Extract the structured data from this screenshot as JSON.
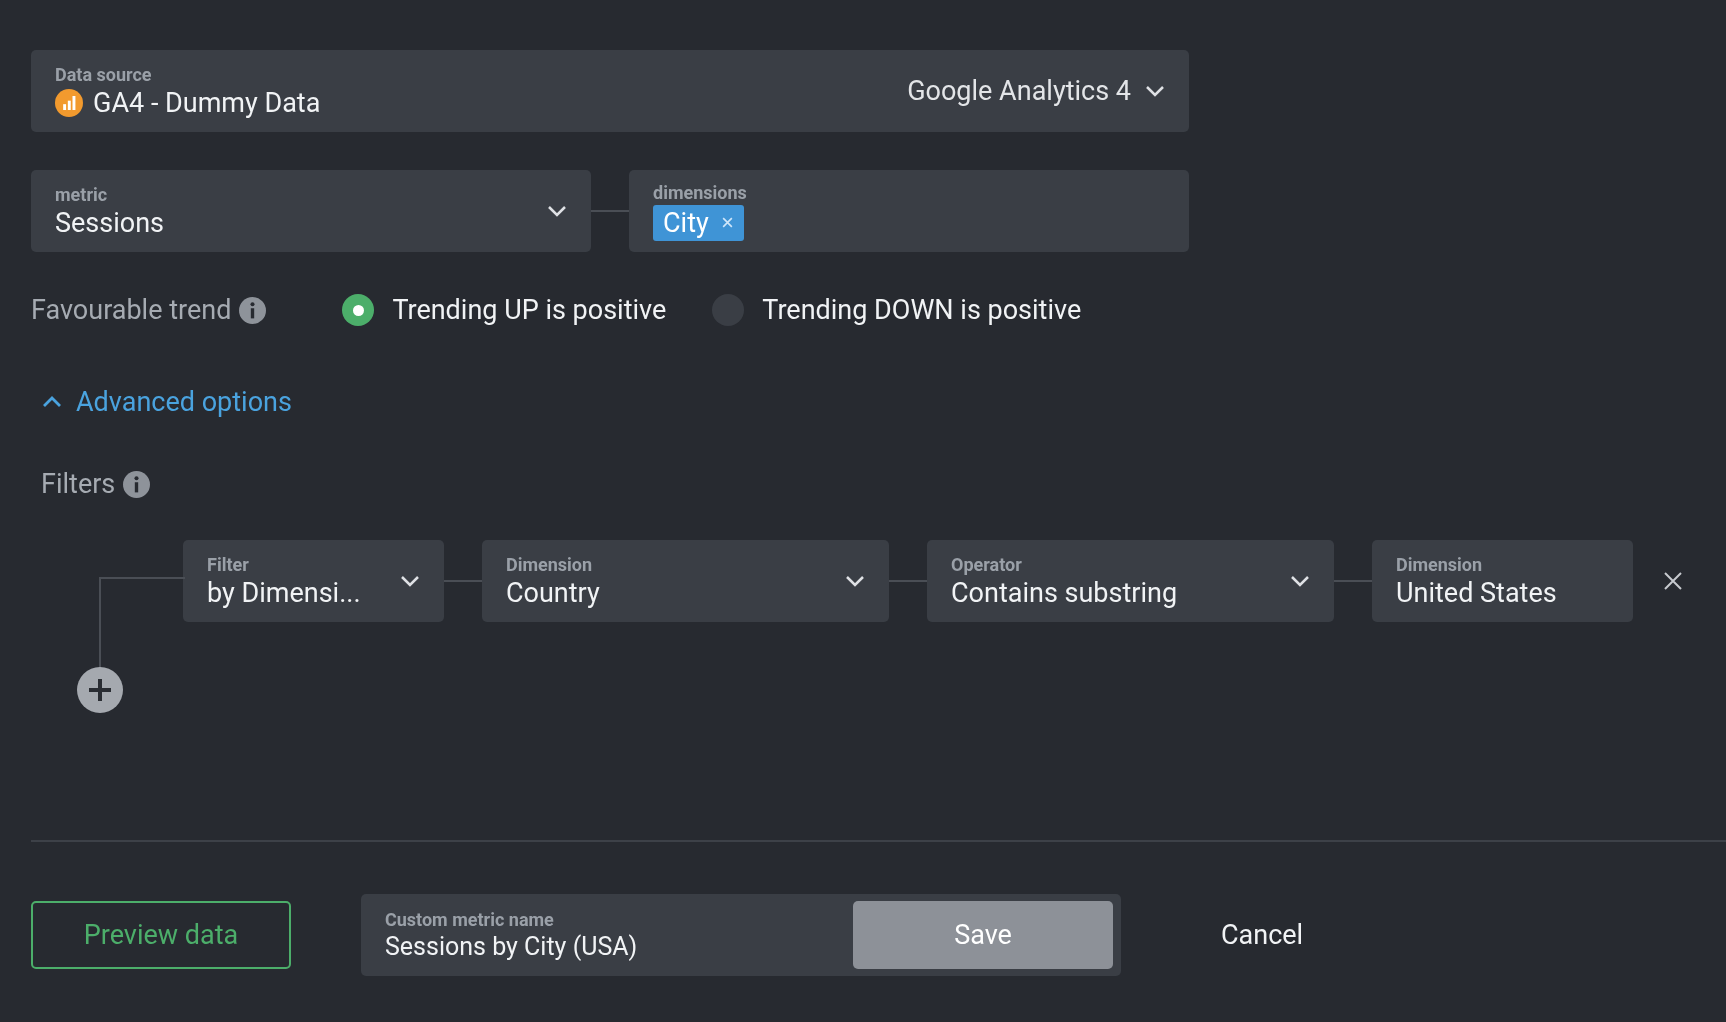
{
  "data_source": {
    "label": "Data source",
    "value": "GA4 - Dummy Data",
    "provider": "Google Analytics 4"
  },
  "metric": {
    "label": "metric",
    "value": "Sessions"
  },
  "dimensions": {
    "label": "dimensions",
    "tags": [
      {
        "text": "City"
      }
    ]
  },
  "trend": {
    "label": "Favourable trend",
    "options": [
      {
        "label": "Trending UP is positive",
        "selected": true
      },
      {
        "label": "Trending DOWN is positive",
        "selected": false
      }
    ]
  },
  "advanced": {
    "label": "Advanced options",
    "expanded": true
  },
  "filters": {
    "label": "Filters",
    "rows": [
      {
        "fields": [
          {
            "kind": "dropdown",
            "label": "Filter",
            "value": "by Dimensi..."
          },
          {
            "kind": "dropdown",
            "label": "Dimension",
            "value": "Country"
          },
          {
            "kind": "dropdown",
            "label": "Operator",
            "value": "Contains substring"
          },
          {
            "kind": "text",
            "label": "Dimension",
            "value": "United States"
          }
        ]
      }
    ]
  },
  "footer": {
    "preview": "Preview data",
    "custom_name": {
      "label": "Custom metric name",
      "value": "Sessions by City (USA)"
    },
    "save": "Save",
    "cancel": "Cancel"
  }
}
